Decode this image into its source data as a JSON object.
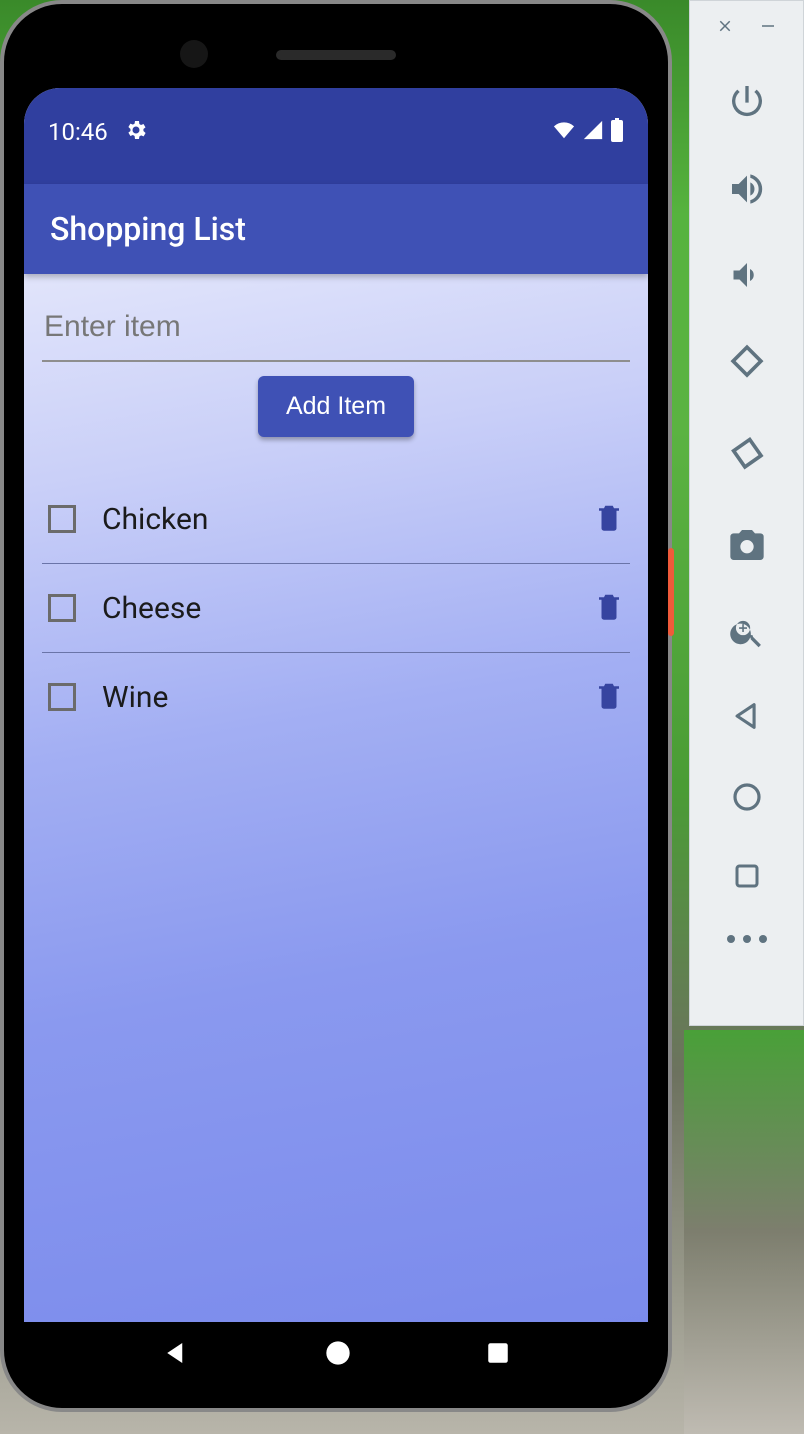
{
  "status": {
    "time": "10:46"
  },
  "app": {
    "title": "Shopping List"
  },
  "input": {
    "placeholder": "Enter item",
    "add_label": "Add Item"
  },
  "items": [
    {
      "label": "Chicken"
    },
    {
      "label": "Cheese"
    },
    {
      "label": "Wine"
    }
  ]
}
